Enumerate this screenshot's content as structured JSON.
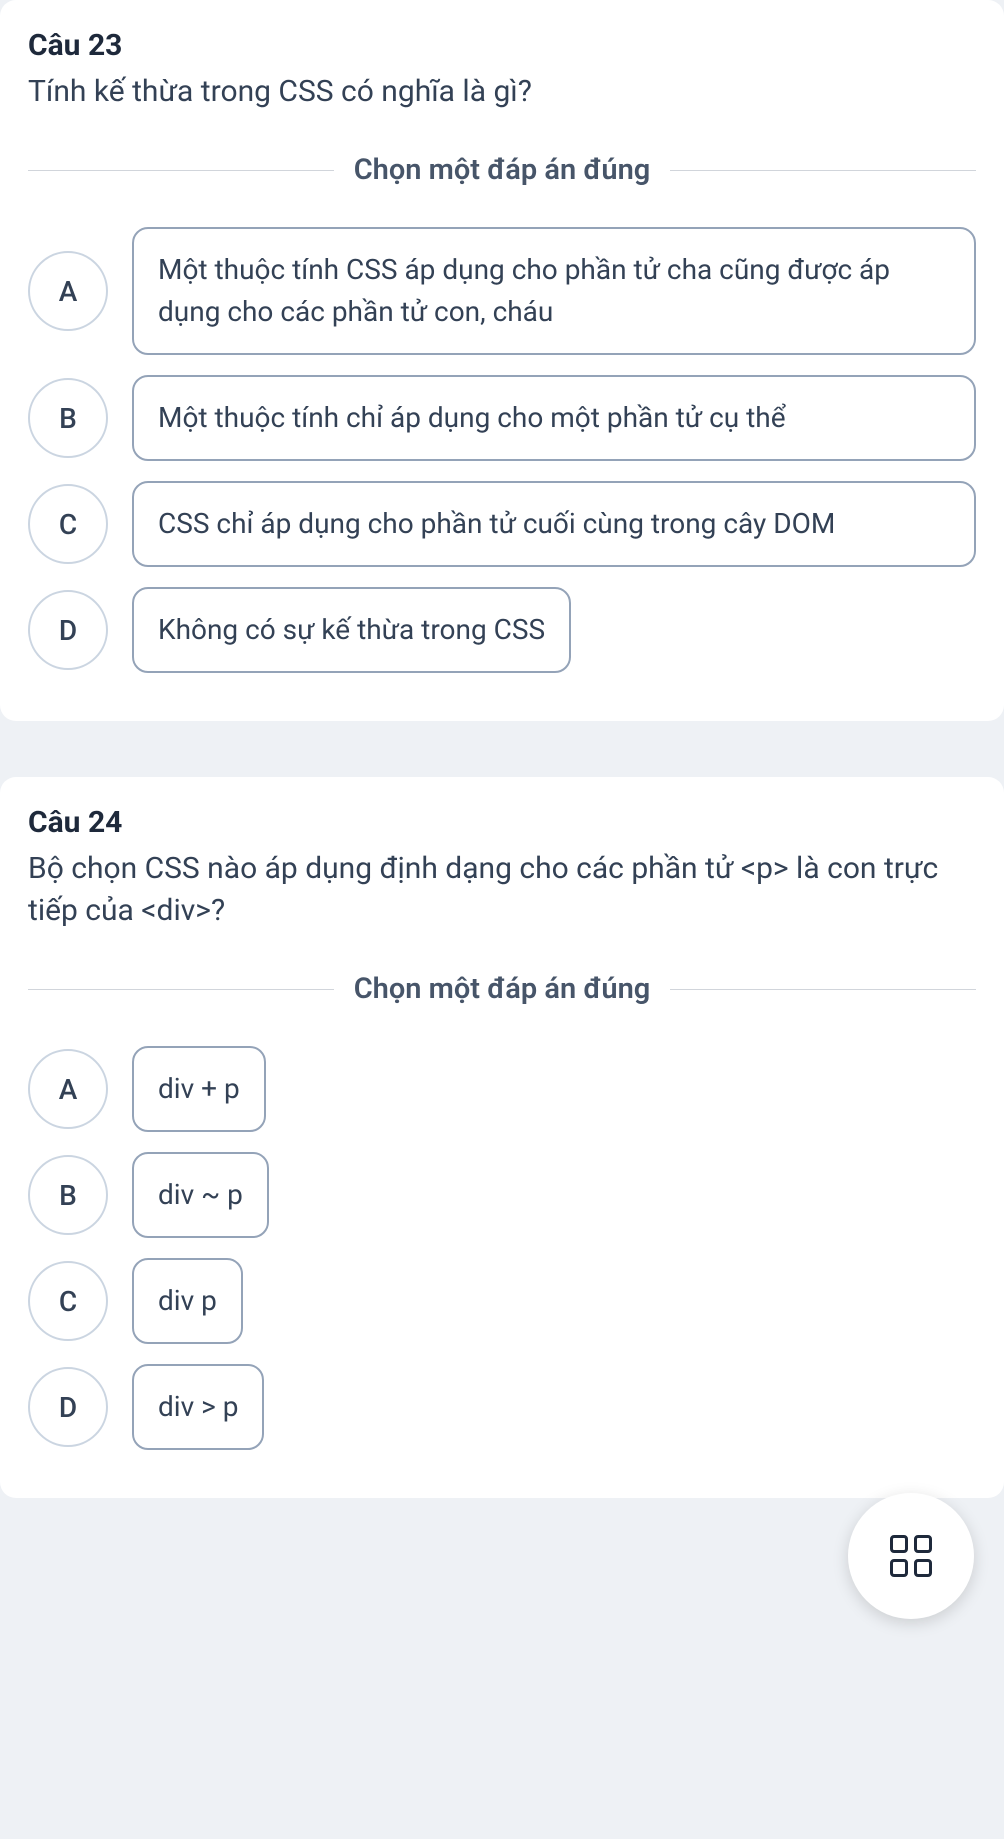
{
  "questions": [
    {
      "title": "Câu 23",
      "text": "Tính kế thừa trong CSS có nghĩa là gì?",
      "prompt": "Chọn một đáp án đúng",
      "options": [
        {
          "letter": "A",
          "text": "Một thuộc tính CSS áp dụng cho phần tử cha cũng được áp dụng cho các phần tử con, cháu",
          "full": true
        },
        {
          "letter": "B",
          "text": "Một thuộc tính chỉ áp dụng cho một phần tử cụ thể",
          "full": true
        },
        {
          "letter": "C",
          "text": "CSS chỉ áp dụng cho phần tử cuối cùng trong cây DOM",
          "full": true
        },
        {
          "letter": "D",
          "text": "Không có sự kế thừa trong CSS",
          "full": false
        }
      ]
    },
    {
      "title": "Câu 24",
      "text": "Bộ chọn CSS nào áp dụng định dạng cho các phần tử <p> là con trực tiếp của <div>?",
      "prompt": "Chọn một đáp án đúng",
      "options": [
        {
          "letter": "A",
          "text": "div + p",
          "full": false
        },
        {
          "letter": "B",
          "text": "div ~ p",
          "full": false
        },
        {
          "letter": "C",
          "text": "div p",
          "full": false
        },
        {
          "letter": "D",
          "text": "div > p",
          "full": false
        }
      ]
    }
  ]
}
